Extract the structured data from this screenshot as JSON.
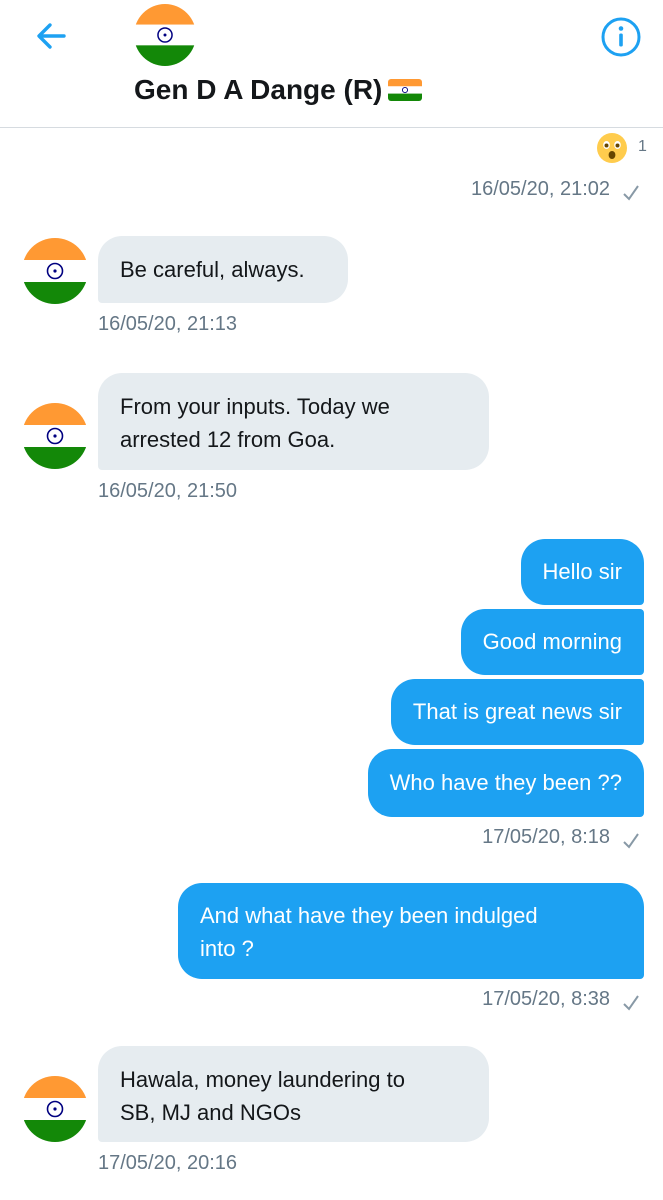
{
  "header": {
    "contact_name": "Gen D A Dange (R)",
    "back_icon": "arrow-left-icon",
    "info_icon": "info-icon",
    "accent_color": "#1da1f2"
  },
  "reaction": {
    "emoji": "😲",
    "count": "1"
  },
  "messages": [
    {
      "direction": "out",
      "timestamp": "16/05/20, 21:02"
    },
    {
      "direction": "in",
      "lines": [
        "Be careful, always."
      ],
      "timestamp": "16/05/20, 21:13"
    },
    {
      "direction": "in",
      "lines": [
        "From your inputs. Today we",
        "arrested 12 from Goa."
      ],
      "timestamp": "16/05/20, 21:50"
    },
    {
      "direction": "out",
      "lines": [
        "Hello sir"
      ]
    },
    {
      "direction": "out",
      "lines": [
        "Good morning"
      ]
    },
    {
      "direction": "out",
      "lines": [
        "That is great news sir"
      ]
    },
    {
      "direction": "out",
      "lines": [
        "Who have they been ??"
      ],
      "timestamp": "17/05/20, 8:18"
    },
    {
      "direction": "out",
      "lines": [
        "And what have they been indulged",
        "into ?"
      ],
      "timestamp": "17/05/20, 8:38"
    },
    {
      "direction": "in",
      "lines": [
        "Hawala, money laundering to",
        "SB, MJ and NGOs"
      ],
      "timestamp": "17/05/20, 20:16"
    }
  ]
}
